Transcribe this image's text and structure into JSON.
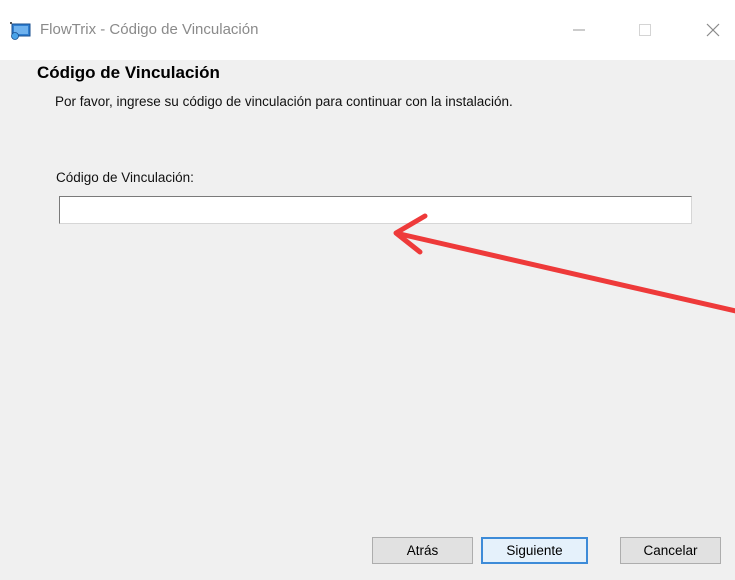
{
  "window": {
    "title": "FlowTrix - Código de Vinculación",
    "icon": "installer-app-icon",
    "controls": {
      "minimize_icon": "minimize-icon",
      "maximize_icon": "maximize-icon",
      "close_icon": "close-icon"
    }
  },
  "page": {
    "heading": "Código de Vinculación",
    "description": "Por favor, ingrese su código de vinculación para continuar con la instalación."
  },
  "form": {
    "code_label": "Código de Vinculación:",
    "code_value": "",
    "code_placeholder": ""
  },
  "annotation": {
    "color": "#ee3a3a",
    "points_to": "code-input"
  },
  "buttons": {
    "back_label": "Atrás",
    "next_label": "Siguiente",
    "cancel_label": "Cancelar"
  },
  "colors": {
    "dialog_background": "#f0f0f0",
    "default_button_border": "#3d8bd8"
  }
}
